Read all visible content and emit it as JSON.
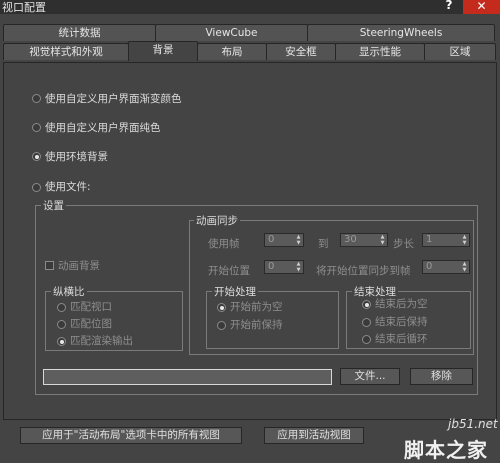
{
  "window": {
    "title": "视口配置",
    "help": "?",
    "close": "✕"
  },
  "tabs_row1": [
    "统计数据",
    "ViewCube",
    "SteeringWheels"
  ],
  "tabs_row2": [
    "视觉样式和外观",
    "背景",
    "布局",
    "安全框",
    "显示性能",
    "区域"
  ],
  "active_tab": "背景",
  "background": {
    "options": [
      "使用自定义用户界面渐变颜色",
      "使用自定义用户界面纯色",
      "使用环境背景",
      "使用文件:"
    ],
    "selected": "使用环境背景"
  },
  "settings": {
    "title": "设置",
    "animate_bg": "动画背景",
    "aspect": {
      "title": "纵横比",
      "options": [
        "匹配视口",
        "匹配位图",
        "匹配渲染输出"
      ],
      "selected": "匹配渲染输出"
    },
    "anim_sync": {
      "title": "动画同步",
      "use_frame": "使用帧",
      "use_frame_val": "0",
      "to": "到",
      "to_val": "30",
      "step": "步长",
      "step_val": "1",
      "start_pos": "开始位置",
      "start_pos_val": "0",
      "sync_start": "将开始位置同步到帧",
      "sync_start_val": "0"
    },
    "start_proc": {
      "title": "开始处理",
      "options": [
        "开始前为空",
        "开始前保持"
      ],
      "selected": "开始前为空"
    },
    "end_proc": {
      "title": "结束处理",
      "options": [
        "结束后为空",
        "结束后保持",
        "结束后循环"
      ],
      "selected": "结束后为空"
    },
    "file_path": "",
    "file_button": "文件...",
    "remove_button": "移除"
  },
  "footer": {
    "apply_all": "应用于\"活动布局\"选项卡中的所有视图",
    "apply_active": "应用到活动视图"
  },
  "watermark": {
    "line1": "jb51.net",
    "line2": "脚本之家"
  }
}
